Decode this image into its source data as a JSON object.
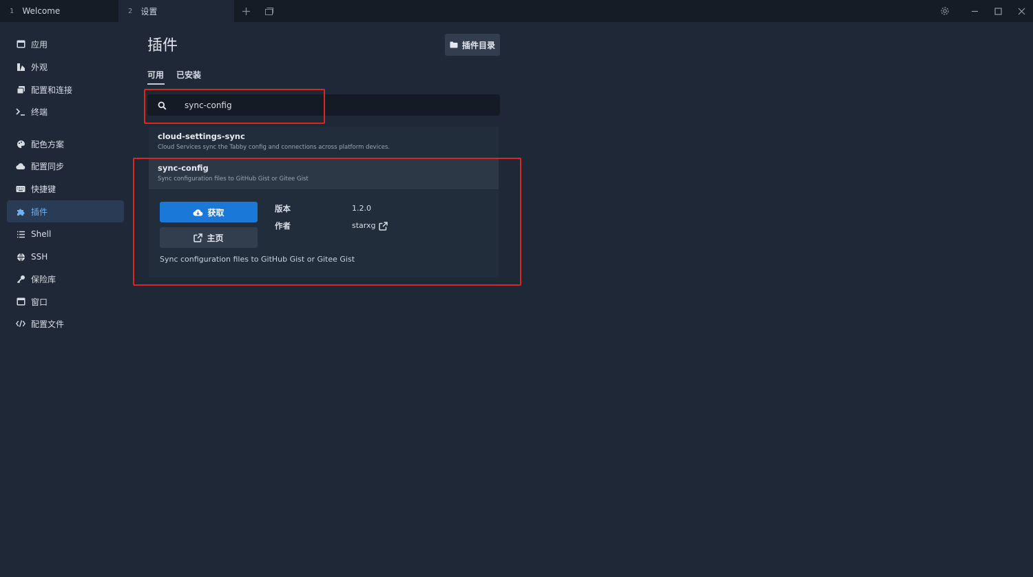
{
  "tabs": [
    {
      "index": "1",
      "label": "Welcome"
    },
    {
      "index": "2",
      "label": "设置"
    }
  ],
  "sidebar": {
    "items": [
      {
        "label": "应用",
        "icon": "window-icon"
      },
      {
        "label": "外观",
        "icon": "brush-icon"
      },
      {
        "label": "配置和连接",
        "icon": "windows-stack-icon"
      },
      {
        "label": "终端",
        "icon": "terminal-icon"
      },
      {
        "label": "配色方案",
        "icon": "palette-icon"
      },
      {
        "label": "配置同步",
        "icon": "cloud-icon"
      },
      {
        "label": "快捷键",
        "icon": "keyboard-icon"
      },
      {
        "label": "插件",
        "icon": "puzzle-icon",
        "active": true
      },
      {
        "label": "Shell",
        "icon": "list-icon"
      },
      {
        "label": "SSH",
        "icon": "globe-icon"
      },
      {
        "label": "保险库",
        "icon": "key-icon"
      },
      {
        "label": "窗口",
        "icon": "window-icon"
      },
      {
        "label": "配置文件",
        "icon": "code-icon"
      }
    ]
  },
  "main": {
    "title": "插件",
    "plugin_dir_button": "插件目录",
    "subtabs": [
      "可用",
      "已安装"
    ],
    "search": {
      "value": "sync-config",
      "placeholder": ""
    },
    "plugins": [
      {
        "name": "cloud-settings-sync",
        "description": "Cloud Services sync the Tabby config and connections across platform devices."
      },
      {
        "name": "sync-config",
        "description": "Sync configuration files to GitHub Gist or Gitee Gist"
      }
    ],
    "detail": {
      "get_button": "获取",
      "home_button": "主页",
      "version_label": "版本",
      "version_value": "1.2.0",
      "author_label": "作者",
      "author_value": "starxg",
      "description": "Sync configuration files to GitHub Gist or Gitee Gist"
    }
  },
  "colors": {
    "accent": "#1a79d8",
    "active_nav_text": "#6fb1f4",
    "highlight_box": "#e1251b"
  }
}
